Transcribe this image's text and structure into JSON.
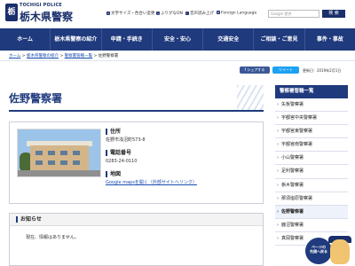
{
  "header": {
    "logo_badge": "栃",
    "logo_sub": "TOCHIGI POLICE",
    "logo_main": "栃木県警察",
    "utils": [
      {
        "icon": "text-size-icon",
        "glyph": "A",
        "label": "文字サイズ・色合い変更"
      },
      {
        "icon": "furigana-icon",
        "glyph": "ふ",
        "label": "ふりがなON"
      },
      {
        "icon": "speaker-icon",
        "glyph": "♪",
        "label": "音声読み上げ"
      },
      {
        "icon": "globe-icon",
        "glyph": "⊕",
        "label": "Foreign Language"
      }
    ],
    "search_placeholder": "Google 提供 ",
    "search_button": "検 索"
  },
  "nav": {
    "items": [
      "ホーム",
      "栃木県警察の紹介",
      "申請・手続き",
      "安全・安心",
      "交通安全",
      "ご相談・ご意見",
      "事件・事故"
    ]
  },
  "breadcrumb": {
    "items": [
      "ホーム",
      "栃木県警察の紹介",
      "警察署管轄一覧",
      "佐野警察署"
    ],
    "separator": " > "
  },
  "share": {
    "facebook": "f シェアする",
    "twitter": "ツイート"
  },
  "updated": "更新日：2019年2月1日",
  "page_title": "佐野警察署",
  "station": {
    "address_label": "住所",
    "address_value": "佐野市浅沼町573-8",
    "phone_label": "電話番号",
    "phone_value": "0283-24-0110",
    "map_label": "地図",
    "map_link": "Google mapsを開く（外部サイトへリンク）"
  },
  "notice": {
    "title": "お知らせ",
    "body": "現在、情報はありません。"
  },
  "sidebar": {
    "title": "警察署管轄一覧",
    "items": [
      "矢板警察署",
      "宇都宮中央警察署",
      "宇都宮東警察署",
      "宇都宮南警察署",
      "小山警察署",
      "足利警察署",
      "栃木警察署",
      "那須塩原警察署",
      "佐野警察署",
      "鹿沼警察署",
      "真岡警察署"
    ],
    "active_index": 8
  },
  "to_top": {
    "line1": "ページの",
    "line2": "先頭へ戻る"
  }
}
